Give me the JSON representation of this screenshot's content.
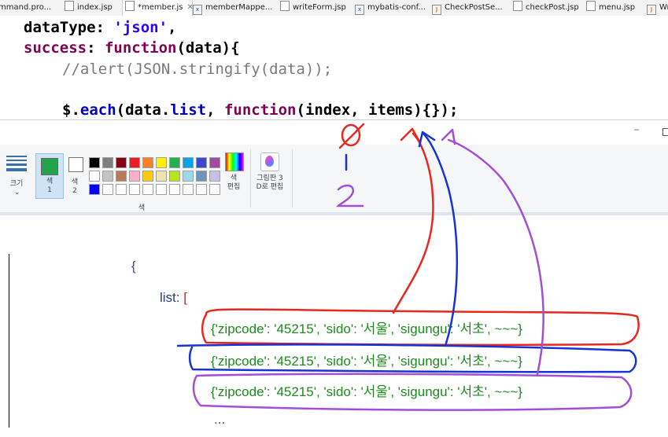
{
  "editor_tabs": [
    {
      "label": "mmand.pro...",
      "icon": "file-icon"
    },
    {
      "label": "index.jsp",
      "icon": "file-icon"
    },
    {
      "label": "*member.js",
      "icon": "file-icon",
      "active": true,
      "close": "✕"
    },
    {
      "label": "memberMappe...",
      "icon": "xml-file-icon"
    },
    {
      "label": "writeForm.jsp",
      "icon": "file-icon"
    },
    {
      "label": "mybatis-conf...",
      "icon": "xml-file-icon"
    },
    {
      "label": "CheckPostSe...",
      "icon": "java-file-icon"
    },
    {
      "label": "checkPost.jsp",
      "icon": "file-icon"
    },
    {
      "label": "menu.jsp",
      "icon": "file-icon"
    },
    {
      "label": "Wr",
      "icon": "java-file-icon"
    }
  ],
  "code": {
    "line1": {
      "key": "dataType",
      "colon": ": ",
      "value": "'json'",
      "tail": ","
    },
    "line2": {
      "key": "success",
      "colon": ": ",
      "kw": "function",
      "rest": "(data){"
    },
    "line3": {
      "comment": "//alert(JSON.stringify(data));"
    },
    "line4": {
      "dollar": "$.",
      "each": "each",
      "open": "(",
      "obj": "data",
      "dot": ".",
      "field": "list",
      "mid": ", ",
      "kw": "function",
      "args": "(index, items){});"
    }
  },
  "paint": {
    "window_controls": {
      "minimize": "–",
      "maximize": "□"
    },
    "ribbon": {
      "size_label": "크기",
      "color1_label": "색\n1",
      "color2_label": "색\n2",
      "colors_group_label": "색",
      "edit_colors_label": "색\n편집",
      "paint3d_label": "그림판 3\nD로 편집"
    },
    "palette_row1": [
      "#000000",
      "#7f7f7f",
      "#880015",
      "#ed1c24",
      "#ff7f27",
      "#fff200",
      "#22b14c",
      "#00a2e8",
      "#3f48cc",
      "#a349a4"
    ],
    "palette_row2": [
      "#ffffff",
      "#c3c3c3",
      "#b97a57",
      "#ffaec9",
      "#ffc90e",
      "#efe4b0",
      "#b5e61d",
      "#99d9ea",
      "#7092be",
      "#c8bfe7"
    ],
    "palette_row3": [
      "#0000ff",
      "#ffffff",
      "#ffffff",
      "#ffffff",
      "#ffffff",
      "#ffffff",
      "#ffffff",
      "#ffffff",
      "#ffffff",
      "#ffffff"
    ]
  },
  "canvas_text": {
    "brace": "{",
    "list_key": "list: ",
    "list_bracket": "[",
    "rows": [
      "{'zipcode': '45215', 'sido': '서울', 'sigungu': '서초', ~~~}",
      "{'zipcode': '45215', 'sido': '서울', 'sigungu': '서초', ~~~}",
      "{'zipcode': '45215', 'sido': '서울', 'sigungu': '서초', ~~~}"
    ],
    "ellipsis": "..."
  },
  "annotations": {
    "index_zero": "0",
    "index_one": "1",
    "index_two": "2"
  },
  "colors": {
    "red_ink": "#e8271f",
    "blue_ink": "#1733d6",
    "purple_ink": "#a24fd6",
    "json_row_green": "#1e8a1e"
  }
}
